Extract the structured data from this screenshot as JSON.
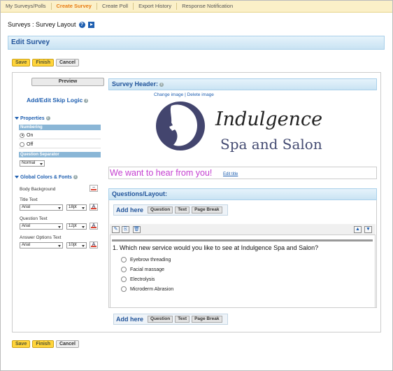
{
  "nav": {
    "tabs": [
      "My Surveys/Polls",
      "Create Survey",
      "Create Poll",
      "Export History",
      "Response Notification"
    ]
  },
  "breadcrumb": "Surveys : Survey Layout",
  "edit_header": "Edit Survey",
  "buttons": {
    "save": "Save",
    "finish": "Finish",
    "cancel": "Cancel"
  },
  "left": {
    "preview": "Preview",
    "skip_logic": "Add/Edit Skip Logic",
    "properties": "Properties",
    "numbering": "Numbering",
    "on": "On",
    "off": "Off",
    "question_separator": "Question Separator",
    "separator_value": "Normal",
    "global_colors": "Global Colors & Fonts",
    "body_background": "Body Background",
    "title_text": "Title Text",
    "question_text": "Question Text",
    "answer_text": "Answer Options Text",
    "font": "Arial",
    "title_size": "18pt",
    "question_size": "12pt",
    "answer_size": "10pt"
  },
  "header": {
    "label": "Survey Header:",
    "change_image": "Change image",
    "sep": "|",
    "delete_image": "Delete image",
    "logo_script": "Indulgence",
    "logo_sub": "Spa and Salon"
  },
  "survey_title": "We want to hear from you!",
  "edit_title": "Edit title",
  "questions": {
    "label": "Questions/Layout:",
    "add_here": "Add here",
    "question_btn": "Question",
    "text_btn": "Text",
    "page_break_btn": "Page Break",
    "q1": "1. Which new service would you like to see at Indulgence Spa and Salon?",
    "options": [
      "Eyebrow threading",
      "Facial massage",
      "Electrolysis",
      "Microderm Abrasion"
    ]
  }
}
